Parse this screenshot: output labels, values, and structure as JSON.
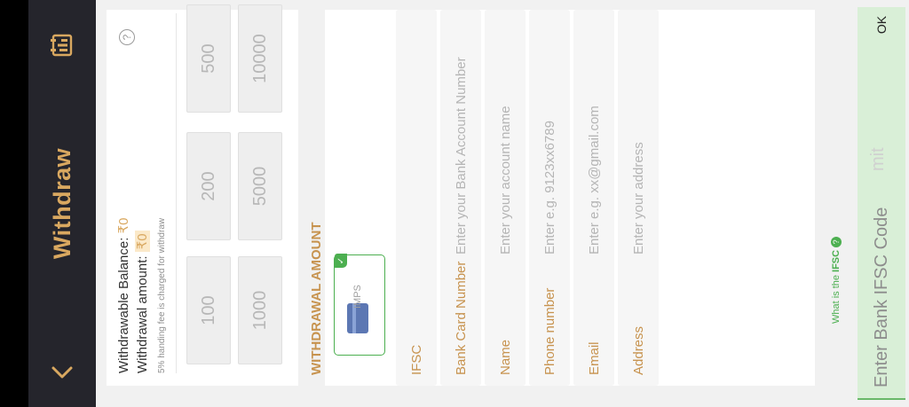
{
  "header": {
    "title": "Withdraw",
    "back_icon": "chevron-left-icon",
    "history_icon": "receipt-icon",
    "accent": "#d9a860"
  },
  "balance": {
    "withdrawable_label": "Withdrawable Balance:",
    "withdrawable_value": "₹0",
    "amount_label": "Withdrawal amount:",
    "amount_value": "₹0",
    "fee_note": "5% handing fee is charged for withdraw",
    "help_icon": "?"
  },
  "amount_options": {
    "row1": [
      "100",
      "200",
      "500"
    ],
    "row2": [
      "1000",
      "5000",
      "10000"
    ]
  },
  "withdrawal": {
    "section_title": "WITHDRAWAL AMOUNT",
    "method": {
      "label": "IMPS",
      "selected": true,
      "check_icon": "✓"
    },
    "fields": [
      {
        "key": "ifsc",
        "label": "IFSC",
        "placeholder": "",
        "value": ""
      },
      {
        "key": "bank_card",
        "label": "Bank Card Number",
        "placeholder": "Enter your Bank Account Number",
        "value": ""
      },
      {
        "key": "name",
        "label": "Name",
        "placeholder": "Enter your account name",
        "value": ""
      },
      {
        "key": "phone",
        "label": "Phone number",
        "placeholder": "Enter e.g. 9123xx6789",
        "value": ""
      },
      {
        "key": "email",
        "label": "Email",
        "placeholder": "Enter e.g. xx@gmail.com",
        "value": ""
      },
      {
        "key": "address",
        "label": "Address",
        "placeholder": "Enter your address",
        "value": ""
      }
    ]
  },
  "ifsc_help": {
    "prefix": "What is the",
    "term": "IFSC",
    "icon": "?"
  },
  "ifsc_entry": {
    "placeholder": "Enter Bank IFSC Code",
    "trailing_text": "mit",
    "ok_label": "OK",
    "accent": "#4caf50"
  }
}
